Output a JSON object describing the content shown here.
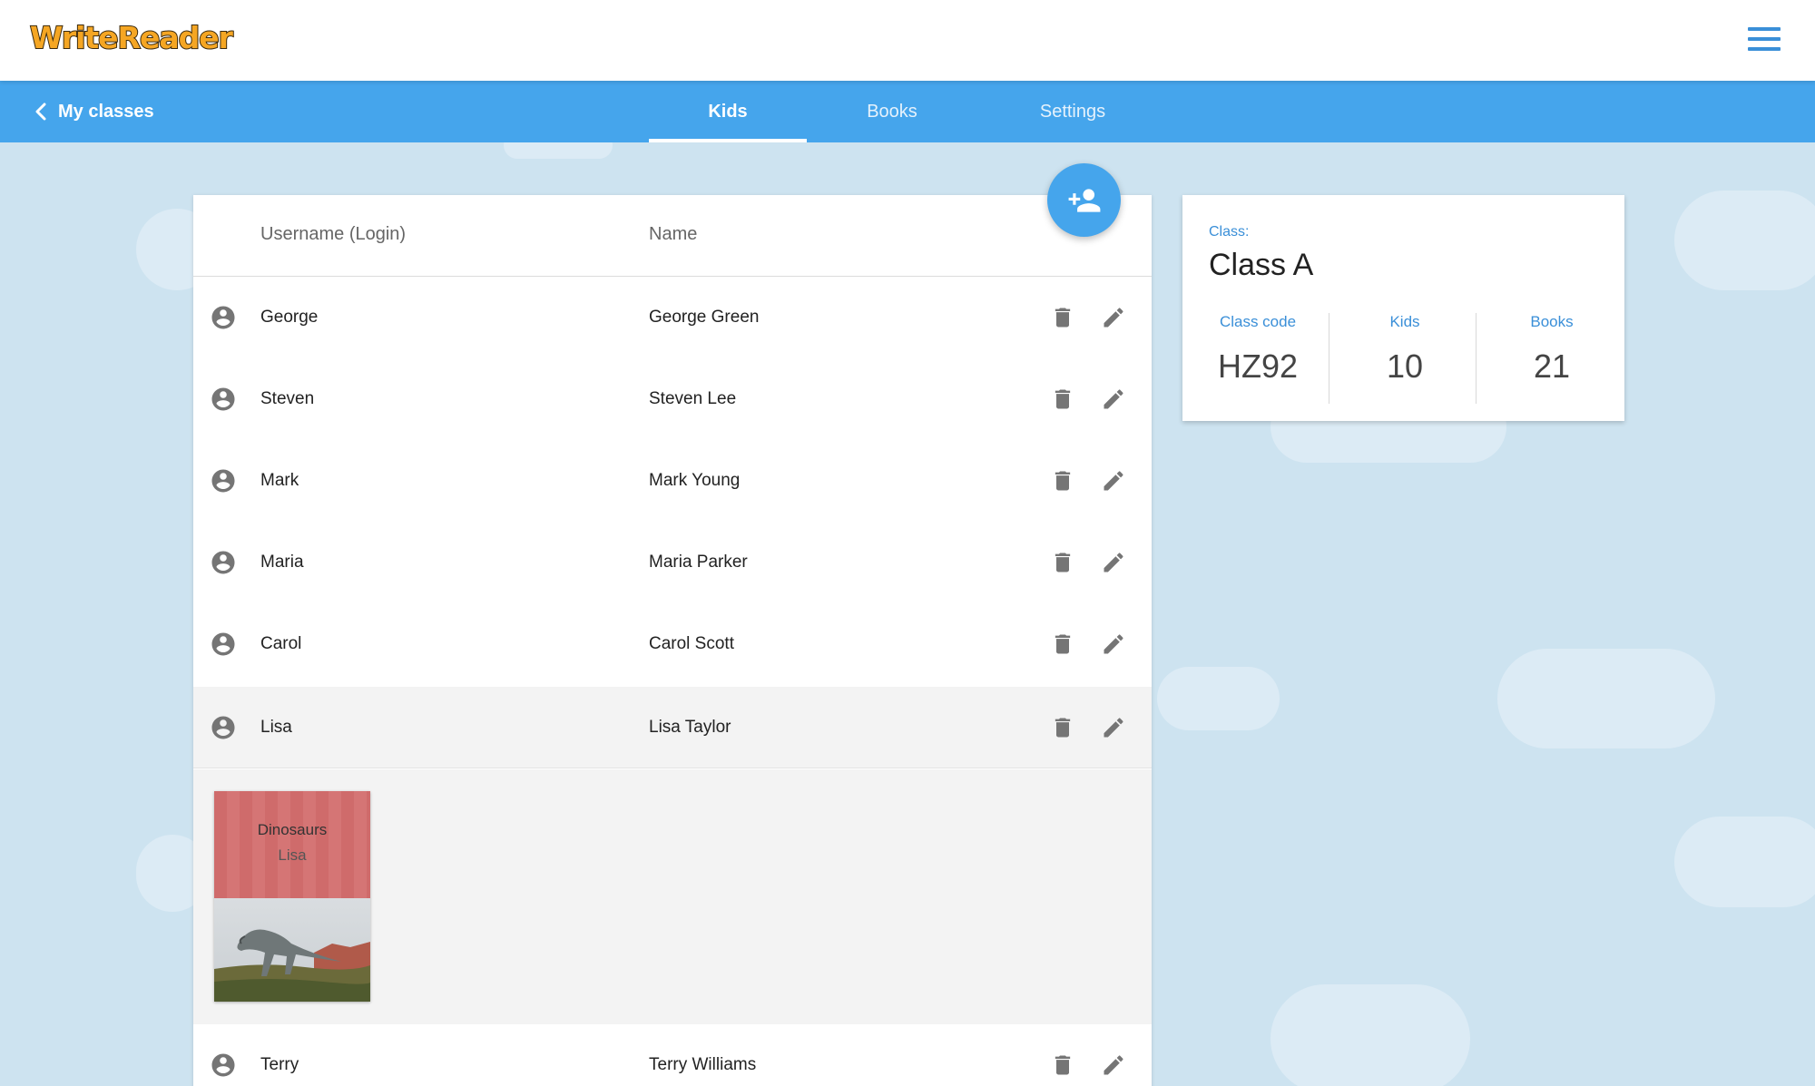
{
  "app": {
    "logo_text": "WriteReader"
  },
  "nav": {
    "back_label": "My classes",
    "tabs": [
      {
        "label": "Kids",
        "active": true
      },
      {
        "label": "Books",
        "active": false
      },
      {
        "label": "Settings",
        "active": false
      }
    ]
  },
  "table": {
    "headers": {
      "username": "Username (Login)",
      "name": "Name"
    },
    "rows": [
      {
        "login": "George",
        "name": "George Green"
      },
      {
        "login": "Steven",
        "name": "Steven Lee"
      },
      {
        "login": "Mark",
        "name": "Mark Young"
      },
      {
        "login": "Maria",
        "name": "Maria Parker"
      },
      {
        "login": "Carol",
        "name": "Carol Scott"
      },
      {
        "login": "Lisa",
        "name": "Lisa Taylor",
        "selected": true
      },
      {
        "login": "Terry",
        "name": "Terry Williams"
      }
    ],
    "expanded_book": {
      "title": "Dinosaurs",
      "author": "Lisa"
    }
  },
  "info": {
    "class_label": "Class:",
    "class_name": "Class A",
    "stats": [
      {
        "label": "Class code",
        "value": "HZ92"
      },
      {
        "label": "Kids",
        "value": "10"
      },
      {
        "label": "Books",
        "value": "21"
      }
    ]
  },
  "colors": {
    "brand_blue": "#45a5ec",
    "background": "#cde3f0",
    "icon_gray": "#757575",
    "book_cover": "#cf6b6b"
  },
  "icons": {
    "menu": "hamburger-icon",
    "back": "chevron-left-icon",
    "add": "add-person-icon",
    "avatar": "account-circle-icon",
    "delete": "trash-icon",
    "edit": "pencil-icon"
  }
}
